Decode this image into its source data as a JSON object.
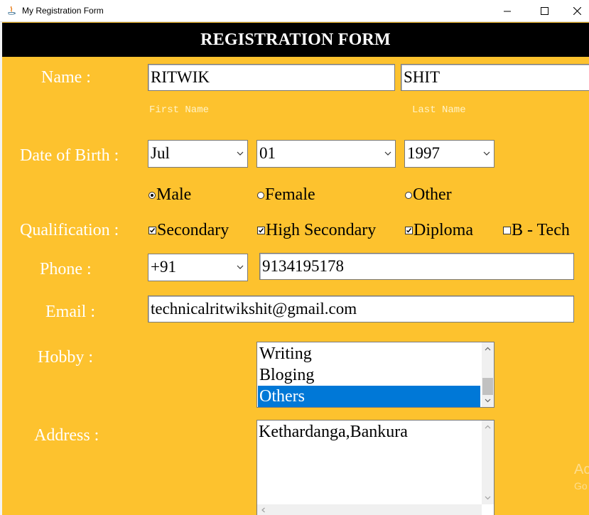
{
  "window": {
    "title": "My Registration Form"
  },
  "header": {
    "title": "REGISTRATION FORM"
  },
  "labels": {
    "name": "Name :",
    "dob": "Date of Birth :",
    "qualification": "Qualification :",
    "phone": "Phone :",
    "email": "Email :",
    "hobby": "Hobby :",
    "address": "Address :"
  },
  "name": {
    "first": "RITWIK",
    "last": "SHIT",
    "first_hint": "First Name",
    "last_hint": "Last Name"
  },
  "dob": {
    "month": "Jul",
    "day": "01",
    "year": "1997"
  },
  "gender": {
    "options": [
      {
        "label": "Male",
        "selected": true
      },
      {
        "label": "Female",
        "selected": false
      },
      {
        "label": "Other",
        "selected": false
      }
    ]
  },
  "qualification": {
    "options": [
      {
        "label": "Secondary",
        "checked": true
      },
      {
        "label": "High Secondary",
        "checked": true
      },
      {
        "label": "Diploma",
        "checked": true
      },
      {
        "label": "B - Tech",
        "checked": false
      }
    ]
  },
  "phone": {
    "code": "+91",
    "number": "9134195178"
  },
  "email": {
    "value": "technicalritwikshit@gmail.com"
  },
  "hobby": {
    "items": [
      {
        "label": "Writing",
        "selected": false
      },
      {
        "label": "Bloging",
        "selected": false
      },
      {
        "label": "Others",
        "selected": true
      }
    ]
  },
  "address": {
    "value": "Kethardanga,Bankura"
  },
  "watermark": {
    "line1": "Ac",
    "line2": "Go"
  },
  "colors": {
    "background": "#FDC22E",
    "header": "#000000",
    "selection": "#0078D7"
  }
}
